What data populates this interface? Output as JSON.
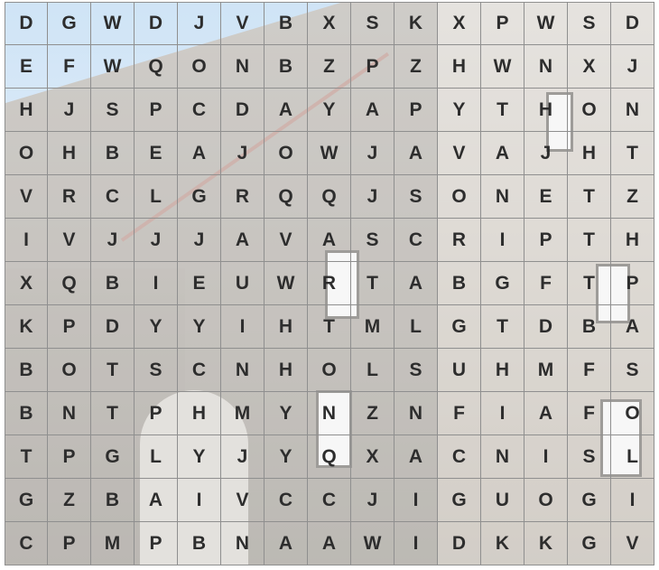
{
  "grid": {
    "rows": [
      [
        "D",
        "G",
        "W",
        "D",
        "J",
        "V",
        "B",
        "X",
        "S",
        "K",
        "X",
        "P",
        "W",
        "S",
        "D"
      ],
      [
        "E",
        "F",
        "W",
        "Q",
        "O",
        "N",
        "B",
        "Z",
        "P",
        "Z",
        "H",
        "W",
        "N",
        "X",
        "J"
      ],
      [
        "H",
        "J",
        "S",
        "P",
        "C",
        "D",
        "A",
        "Y",
        "A",
        "P",
        "Y",
        "T",
        "H",
        "O",
        "N"
      ],
      [
        "O",
        "H",
        "B",
        "E",
        "A",
        "J",
        "O",
        "W",
        "J",
        "A",
        "V",
        "A",
        "J",
        "H",
        "T"
      ],
      [
        "V",
        "R",
        "C",
        "L",
        "G",
        "R",
        "Q",
        "Q",
        "J",
        "S",
        "O",
        "N",
        "E",
        "T",
        "Z"
      ],
      [
        "I",
        "V",
        "J",
        "J",
        "J",
        "A",
        "V",
        "A",
        "S",
        "C",
        "R",
        "I",
        "P",
        "T",
        "H"
      ],
      [
        "X",
        "Q",
        "B",
        "I",
        "E",
        "U",
        "W",
        "R",
        "T",
        "A",
        "B",
        "G",
        "F",
        "T",
        "P"
      ],
      [
        "K",
        "P",
        "D",
        "Y",
        "Y",
        "I",
        "H",
        "T",
        "M",
        "L",
        "G",
        "T",
        "D",
        "B",
        "A"
      ],
      [
        "B",
        "O",
        "T",
        "S",
        "C",
        "N",
        "H",
        "O",
        "L",
        "S",
        "U",
        "H",
        "M",
        "F",
        "S"
      ],
      [
        "B",
        "N",
        "T",
        "P",
        "H",
        "M",
        "Y",
        "N",
        "Z",
        "N",
        "F",
        "I",
        "A",
        "F",
        "O"
      ],
      [
        "T",
        "P",
        "G",
        "L",
        "Y",
        "J",
        "Y",
        "Q",
        "X",
        "A",
        "C",
        "N",
        "I",
        "S",
        "L"
      ],
      [
        "G",
        "Z",
        "B",
        "A",
        "I",
        "V",
        "C",
        "C",
        "J",
        "I",
        "G",
        "U",
        "O",
        "G",
        "I"
      ],
      [
        "C",
        "P",
        "M",
        "P",
        "B",
        "N",
        "A",
        "A",
        "W",
        "I",
        "D",
        "K",
        "K",
        "G",
        "V"
      ]
    ]
  },
  "colors": {
    "letter": "#2d2d2d",
    "grid_line": "#8f8f8f"
  }
}
